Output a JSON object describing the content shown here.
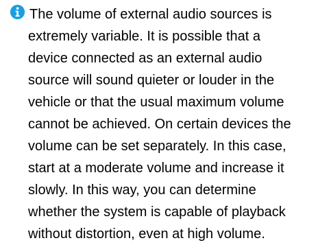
{
  "note": {
    "icon": "info-icon",
    "icon_color": "#1b9fe0",
    "lines": [
      "The volume of external audio sources is",
      "extremely variable. It is possible that a",
      "device connected as an external audio",
      "source will sound quieter or louder in the",
      "vehicle or that the usual maximum volume",
      "cannot be achieved. On certain devices the",
      "volume can be set separately. In this case,",
      "start at a moderate volume and increase it",
      "slowly. In this way, you can determine",
      "whether the system is capable of playback",
      "without distortion, even at high volume."
    ]
  }
}
